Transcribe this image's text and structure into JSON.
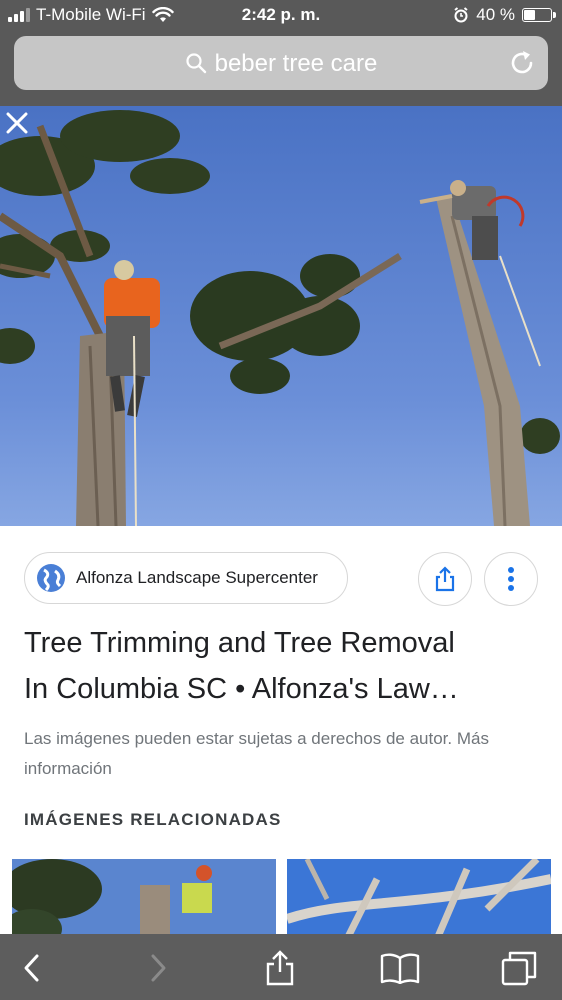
{
  "status_bar": {
    "carrier": "T-Mobile Wi-Fi",
    "time": "2:42 p. m.",
    "battery_percent_label": "40 %",
    "battery_level": 0.4
  },
  "url_bar": {
    "query": "beber tree care",
    "icons": [
      "search-icon",
      "reload-icon"
    ]
  },
  "image_viewer": {
    "close_icon": "close-icon"
  },
  "result": {
    "source_name": "Alfonza Landscape Supercenter",
    "title_line1": "Tree Trimming and Tree Removal",
    "title_line2": "In Columbia SC • Alfonza's Law…",
    "copyright_notice": "Las imágenes pueden estar sujetas a derechos de autor. Más información",
    "related_heading": "IMÁGENES RELACIONADAS"
  },
  "toolbar": {
    "icons": [
      "back-icon",
      "forward-icon",
      "share-icon",
      "bookmarks-icon",
      "tabs-icon"
    ]
  },
  "colors": {
    "chrome_dark": "#595959",
    "url_bar": "#c6c6c6",
    "accent_blue": "#1a73e8",
    "sky": "#4a72c4"
  }
}
